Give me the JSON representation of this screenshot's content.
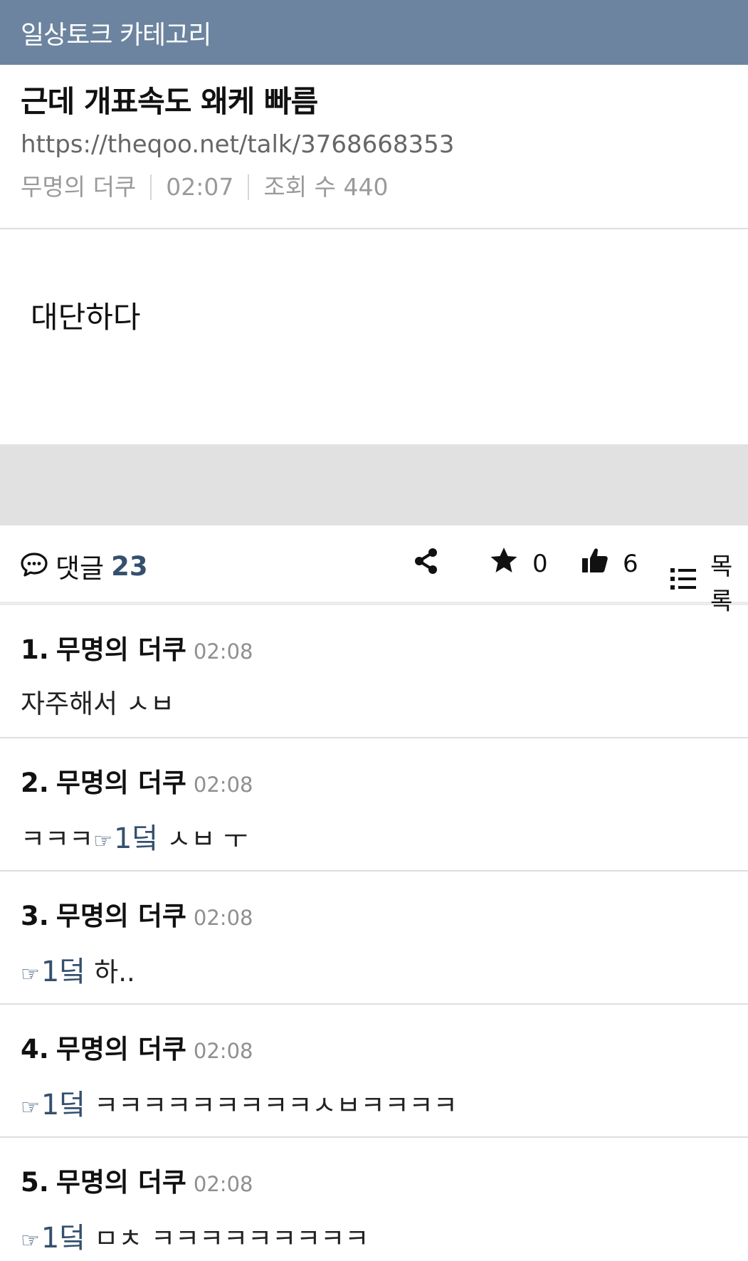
{
  "category": "일상토크 카테고리",
  "post": {
    "title": "근데 개표속도 왜케 빠름",
    "url": "https://theqoo.net/talk/3768668353",
    "author": "무명의 더쿠",
    "time": "02:07",
    "views": "조회 수 440",
    "body": "대단하다"
  },
  "actions": {
    "comment_label": "댓글",
    "comment_count": "23",
    "favorite_count": "0",
    "like_count": "6",
    "list_label": "목록",
    "icons": [
      "speech-bubble-icon",
      "share-icon",
      "star-icon",
      "thumbs-up-icon",
      "list-icon"
    ]
  },
  "comments": [
    {
      "num": "1.",
      "author": "무명의 더쿠",
      "time": "02:08",
      "reply_hand": "",
      "reply_ref": "",
      "text": "자주해서 ㅅㅂ"
    },
    {
      "num": "2.",
      "author": "무명의 더쿠",
      "time": "02:08",
      "prefix": "ㅋㅋㅋ",
      "reply_hand": "☞",
      "reply_ref": "1덬",
      "text": "ㅅㅂ ㅜ"
    },
    {
      "num": "3.",
      "author": "무명의 더쿠",
      "time": "02:08",
      "reply_hand": "☞",
      "reply_ref": "1덬",
      "text": "하.."
    },
    {
      "num": "4.",
      "author": "무명의 더쿠",
      "time": "02:08",
      "reply_hand": "☞",
      "reply_ref": "1덬",
      "text": "ㅋㅋㅋㅋㅋㅋㅋㅋㅋㅅㅂㅋㅋㅋㅋ"
    },
    {
      "num": "5.",
      "author": "무명의 더쿠",
      "time": "02:08",
      "reply_hand": "☞",
      "reply_ref": "1덬",
      "text": "ㅁㅊ ㅋㅋㅋㅋㅋㅋㅋㅋㅋ"
    }
  ]
}
